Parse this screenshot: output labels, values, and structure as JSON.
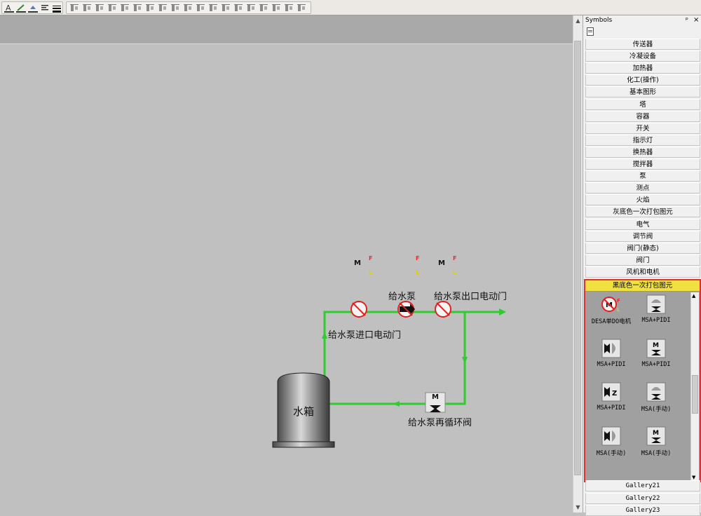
{
  "toolbar": {
    "group1": [
      "text-style-icon",
      "line-color-icon",
      "fill-color-icon",
      "align-text-icon",
      "line-weight-icon"
    ],
    "group2": [
      "group-icon",
      "ungroup-icon",
      "align-left-icon",
      "align-top-icon",
      "align-center-h-icon",
      "align-right-icon",
      "align-bottom-icon",
      "align-center-v-icon",
      "same-width-icon",
      "same-height-icon",
      "distribute-h-icon",
      "distribute-v-icon",
      "bring-front-icon",
      "send-back-icon",
      "flip-h-icon",
      "flip-v-icon",
      "rotate-left-icon",
      "rotate-right-icon",
      "rotate-free-icon"
    ]
  },
  "diagram": {
    "pump_label": "给水泵",
    "outlet_valve_label": "给水泵出口电动门",
    "inlet_valve_label": "给水泵进口电动门",
    "recirc_valve_label": "给水泵再循环阀",
    "tank_label": "水箱",
    "badge_f": "F",
    "badge_l": "L",
    "motor_letter": "M",
    "pipe_color": "#2ecc2e"
  },
  "symbols": {
    "title": "Symbols",
    "pin": "ᵖ",
    "close": "×",
    "categories": [
      "传送器",
      "冷凝设备",
      "加热器",
      "化工(操作)",
      "基本图形",
      "塔",
      "容器",
      "开关",
      "指示灯",
      "换热器",
      "搅拌器",
      "泵",
      "测点",
      "火焰",
      "灰底色一次打包图元",
      "电气",
      "调节阀",
      "阀门(静态)",
      "阀门",
      "风机和电机"
    ],
    "expanded": {
      "title": "黑底色一次打包图元",
      "items": [
        {
          "label": "DESA单DO电机",
          "icon": "motor-no-icon"
        },
        {
          "label": "MSA+PIDI",
          "icon": "dome-valve-icon"
        },
        {
          "label": "MSA+PIDI",
          "icon": "side-valve-icon"
        },
        {
          "label": "MSA+PIDI",
          "icon": "motor-valve-icon"
        },
        {
          "label": "MSA+PIDI",
          "icon": "side-z-valve-icon"
        },
        {
          "label": "MSA(手动)",
          "icon": "dome-valve-icon"
        },
        {
          "label": "MSA(手动)",
          "icon": "side-valve-icon"
        },
        {
          "label": "MSA(手动)",
          "icon": "motor-valve-icon"
        }
      ]
    },
    "galleries": [
      "Gallery21",
      "Gallery22",
      "Gallery23"
    ],
    "highlight_color": "#e03030",
    "expanded_header_color": "#f0e040"
  }
}
